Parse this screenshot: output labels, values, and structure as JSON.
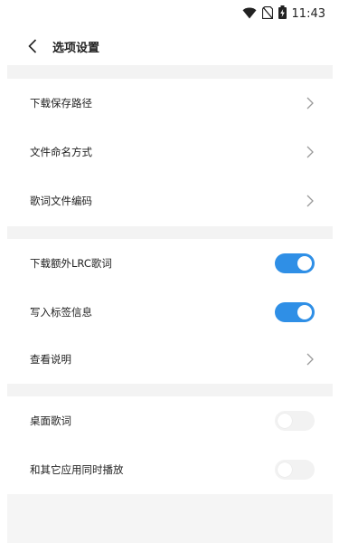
{
  "status_bar": {
    "time": "11:43",
    "icons": [
      "wifi-icon",
      "no-sim-icon",
      "battery-charging-icon"
    ]
  },
  "header": {
    "back_icon": "chevron-left-icon",
    "title": "选项设置"
  },
  "section1": {
    "items": [
      {
        "label": "下载保存路径",
        "control": "chevron"
      },
      {
        "label": "文件命名方式",
        "control": "chevron"
      },
      {
        "label": "歌词文件编码",
        "control": "chevron"
      }
    ]
  },
  "section2": {
    "items": [
      {
        "label": "下载额外LRC歌词",
        "control": "toggle",
        "enabled": true
      },
      {
        "label": "写入标签信息",
        "control": "toggle",
        "enabled": true
      },
      {
        "label": "查看说明",
        "control": "chevron"
      }
    ]
  },
  "section3": {
    "items": [
      {
        "label": "桌面歌词",
        "control": "toggle",
        "enabled": false
      },
      {
        "label": "和其它应用同时播放",
        "control": "toggle",
        "enabled": false
      }
    ]
  },
  "colors": {
    "accent": "#2f8fe6",
    "section_gap": "#f3f3f3",
    "toggle_off": "#f2f2f2"
  }
}
